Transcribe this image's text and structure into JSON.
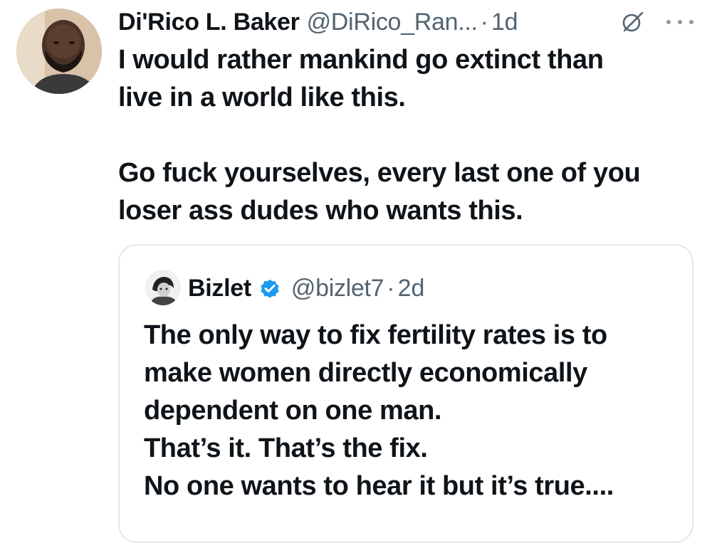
{
  "tweet": {
    "author": {
      "display_name": "Di'Rico L. Baker",
      "handle": "@DiRico_Ran...",
      "avatar_icon": "profile-photo"
    },
    "separator": "·",
    "time": "1d",
    "grok_icon": "grok-icon",
    "more_icon": "more-options-icon",
    "text_lines": [
      "I would rather mankind go extinct than",
      "live in a world like this.",
      "Go fuck yourselves, every last one of you",
      "loser ass dudes who wants this."
    ]
  },
  "quoted_tweet": {
    "author": {
      "display_name": "Bizlet",
      "handle": "@bizlet7",
      "verified": true,
      "verified_color": "#1d9bf0",
      "avatar_icon": "profile-photo"
    },
    "separator": "·",
    "time": "2d",
    "text_lines": [
      "The only way to fix fertility rates is to",
      "make women directly economically",
      "dependent on one man.",
      "That’s it. That’s the fix.",
      "No one wants to hear it but it’s true...."
    ]
  },
  "colors": {
    "primary_text": "#0f1419",
    "secondary_text": "#536471",
    "border": "#e1e8ed",
    "background": "#ffffff"
  }
}
